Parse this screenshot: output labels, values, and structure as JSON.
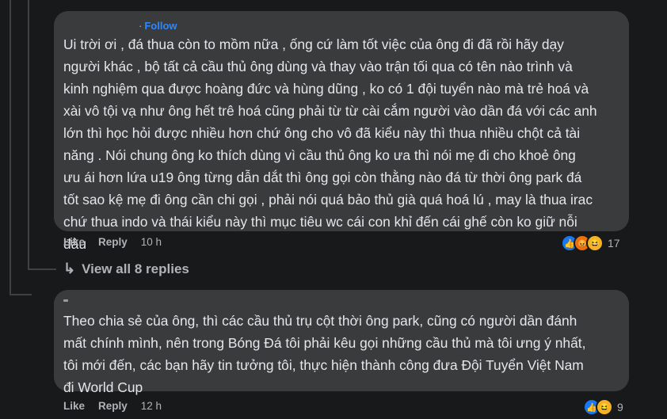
{
  "comment1": {
    "follow_label": "Follow",
    "text": "Ui trời ơi , đá thua còn to mồm nữa , ống cứ làm tốt việc của ông đi đã rồi hãy dạy\nngười khác , bộ tất cả cầu thủ ông dùng và thay vào trận tối qua có tên nào trình và\nkinh nghiệm qua được hoàng đức và hùng dũng , ko có 1 đội tuyển nào mà trẻ hoá và\nxài vô tội vạ như ông hết trê hoá cũng phải từ từ cài cắm người vào dần đá với các anh\nlớn thì học hỏi được nhiều hơn chứ ông cho vô đã kiểu này thì thua nhiều chột cả tài\nnăng . Nói chung ông ko thích dùng vì cầu thủ ông ko ưa thì nói mẹ đi cho khoẻ ông\nưu ái hơn lứa u19 ông từng dẫn dắt thì ông gọi còn thằng nào đá từ thời ông park đá\ntốt sao kệ mẹ đi ông cần chi gọi , phải nói quá bảo thủ già quá hoá lú , may là thua irac\nchứ thua indo và thái kiểu này thì mục tiêu wc cái con khỉ đến cái ghế còn ko giữ nỗi\nđâu",
    "like_label": "Like",
    "reply_label": "Reply",
    "time": "10 h",
    "reaction_count": "17",
    "reactions": [
      "like-icon",
      "angry-icon",
      "haha-icon"
    ]
  },
  "view_replies_label": "View all 8 replies",
  "comment2": {
    "text": "Theo chia sẻ của ông, thì các cầu thủ trụ cột thời ông park, cũng có người dần đánh\nmất chính mình, nên trong Bóng Đá tôi phải kêu gọi những cầu thủ mà tôi ưng ý nhất,\ntôi mới đến, các bạn hãy tin tưởng tôi, thực hiện thành công đưa Đội Tuyển Việt Nam\nđi World Cup",
    "like_label": "Like",
    "reply_label": "Reply",
    "time": "12 h",
    "reaction_count": "9",
    "reactions": [
      "like-icon",
      "haha-icon"
    ]
  },
  "colors": {
    "background": "#18191a",
    "bubble": "#3a3b3c",
    "text": "#e4e6eb",
    "secondary": "#b0b3b8",
    "follow": "#2d88ff",
    "like": "#1877f2"
  }
}
